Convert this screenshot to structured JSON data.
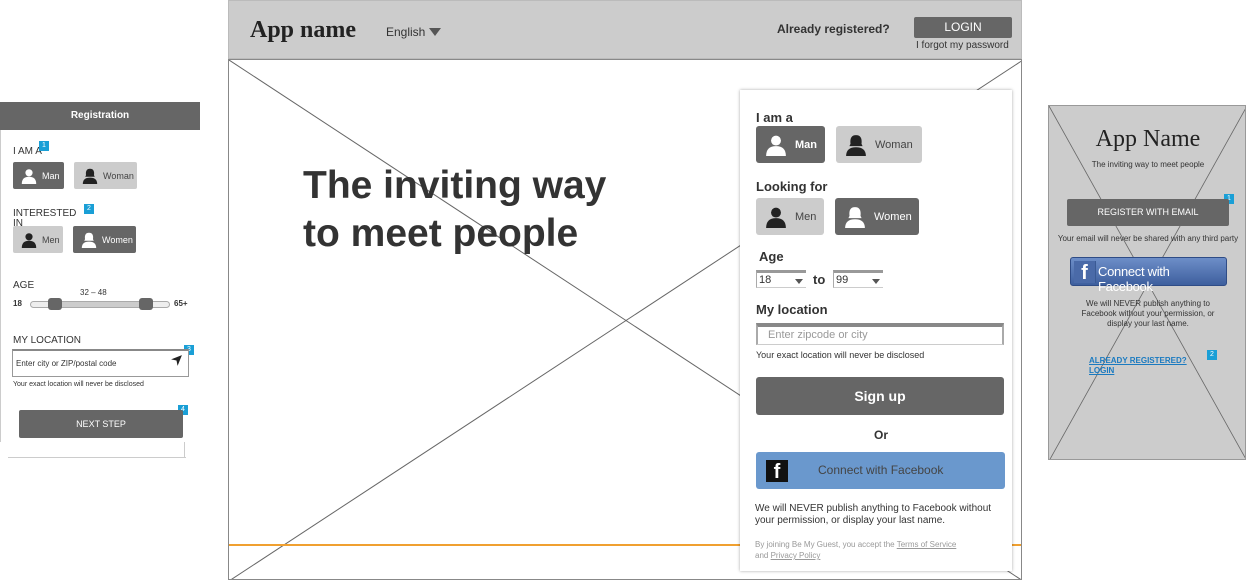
{
  "mobile_left": {
    "header": "Registration",
    "i_am_label": "I AM A",
    "i_am_options": [
      "Man",
      "Woman"
    ],
    "interested_label": "INTERESTED IN",
    "interested_options": [
      "Men",
      "Women"
    ],
    "age_label": "AGE",
    "age_min": "18",
    "age_max": "65+",
    "age_range": "32 – 48",
    "location_label": "MY LOCATION",
    "location_value": "Enter city or ZIP/postal code",
    "location_note": "Your exact location will never be disclosed",
    "next_button": "NEXT STEP",
    "badges": [
      "1",
      "2",
      "3",
      "4"
    ]
  },
  "desktop": {
    "app_name": "App name",
    "language": "English",
    "already_registered": "Already registered?",
    "login": "LOGIN",
    "forgot": "I forgot my password",
    "hero_line1": "The inviting way",
    "hero_line2": "to meet people",
    "form": {
      "i_am_label": "I am a",
      "i_am_options": [
        "Man",
        "Woman"
      ],
      "looking_label": "Looking for",
      "looking_options": [
        "Men",
        "Women"
      ],
      "age_label": "Age",
      "age_from": "18",
      "age_to_word": "to",
      "age_to": "99",
      "location_label": "My location",
      "location_placeholder": "Enter zipcode or city",
      "location_note": "Your exact location will never be disclosed",
      "signup": "Sign up",
      "or": "Or",
      "facebook": "Connect with Facebook",
      "never_publish": "We will NEVER publish anything to Facebook without your permission, or display your last name.",
      "legal_prefix": "By joining Be My Guest, you accept the",
      "terms": "Terms of Service",
      "legal_and": "and",
      "privacy": "Privacy Policy"
    }
  },
  "mobile_right": {
    "app_name": "App Name",
    "tagline": "The inviting way to meet people",
    "register": "REGISTER WITH EMAIL",
    "email_note": "Your email will never be shared with any third party",
    "facebook": "Connect with Facebook",
    "never": "We will NEVER publish anything to Facebook without your permission, or display your last name.",
    "already": "ALREADY REGISTERED?",
    "login": "LOGIN",
    "badges": [
      "1",
      "2"
    ]
  },
  "colors": {
    "accent_badge": "#1a9fd6",
    "button_dark": "#666666",
    "facebook_blue": "#6a98cd",
    "orange_line": "#f0a030"
  }
}
